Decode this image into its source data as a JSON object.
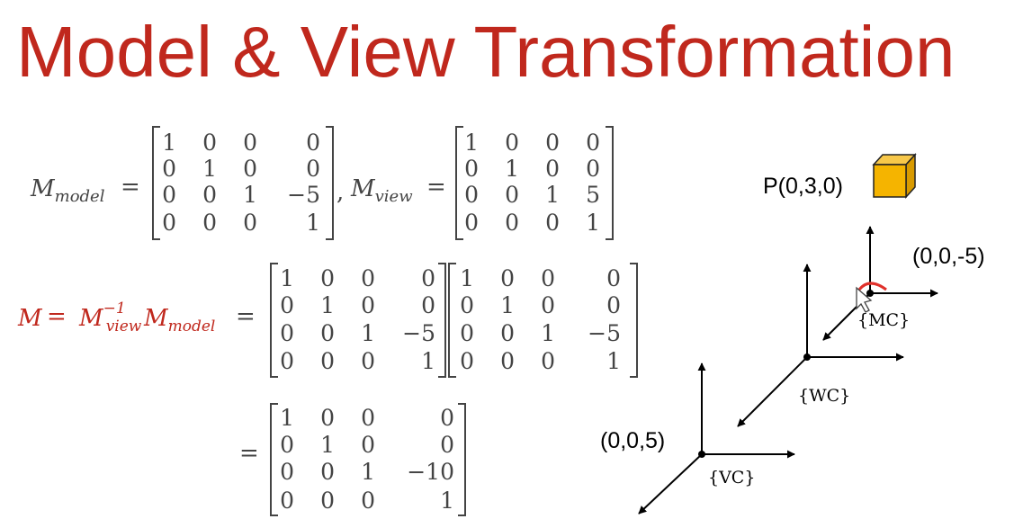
{
  "slide": {
    "title": "Model & View Transformation",
    "accent_color": "#c0281d",
    "text_color": "#444444",
    "cube_color": "#f5b400"
  },
  "equation1": {
    "lhs_main": "M",
    "lhs_sub": "model",
    "eq": "=",
    "matrix": [
      [
        "1",
        "0",
        "0",
        "0"
      ],
      [
        "0",
        "1",
        "0",
        "0"
      ],
      [
        "0",
        "0",
        "1",
        "−5"
      ],
      [
        "0",
        "0",
        "0",
        "1"
      ]
    ],
    "comma": ",",
    "lhs2_main": "M",
    "lhs2_sub": "view",
    "eq2": "=",
    "matrix2": [
      [
        "1",
        "0",
        "0",
        "0"
      ],
      [
        "0",
        "1",
        "0",
        "0"
      ],
      [
        "0",
        "0",
        "1",
        "5"
      ],
      [
        "0",
        "0",
        "0",
        "1"
      ]
    ]
  },
  "equation2": {
    "lhs_main": "M",
    "eq": "=",
    "term1_main": "M",
    "term1_sup": "−1",
    "term1_sub": "view",
    "term2_main": "M",
    "term2_sub": "model",
    "eq2": "=",
    "matrixA": [
      [
        "1",
        "0",
        "0",
        "0"
      ],
      [
        "0",
        "1",
        "0",
        "0"
      ],
      [
        "0",
        "0",
        "1",
        "−5"
      ],
      [
        "0",
        "0",
        "0",
        "1"
      ]
    ],
    "matrixB": [
      [
        "1",
        "0",
        "0",
        "0"
      ],
      [
        "0",
        "1",
        "0",
        "0"
      ],
      [
        "0",
        "0",
        "1",
        "−5"
      ],
      [
        "0",
        "0",
        "0",
        "1"
      ]
    ]
  },
  "equation3": {
    "eq": "=",
    "matrix": [
      [
        "1",
        "0",
        "0",
        "0"
      ],
      [
        "0",
        "1",
        "0",
        "0"
      ],
      [
        "0",
        "0",
        "1",
        "−10"
      ],
      [
        "0",
        "0",
        "0",
        "1"
      ]
    ]
  },
  "diagram": {
    "point_label": "P(0,3,0)",
    "mc_position": "(0,0,-5)",
    "vc_position": "(0,0,5)",
    "mc_label": "{MC}",
    "wc_label": "{WC}",
    "vc_label": "{VC}"
  }
}
